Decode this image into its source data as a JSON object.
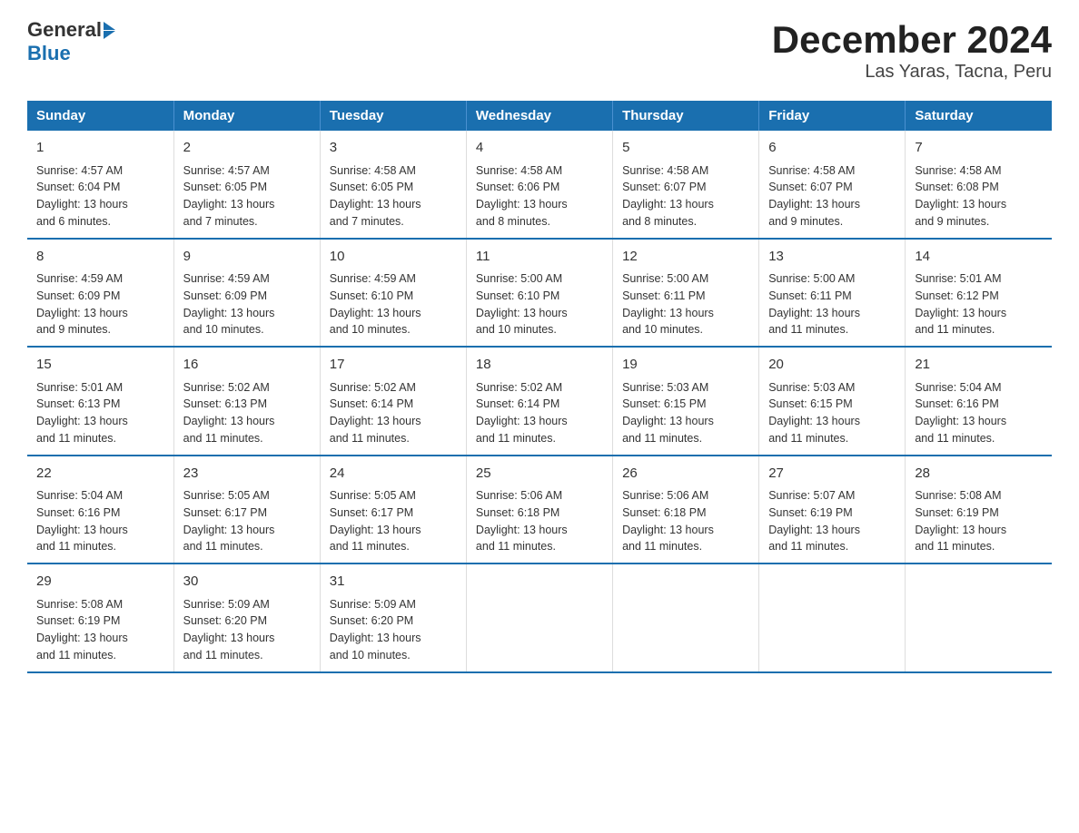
{
  "logo": {
    "general": "General",
    "blue": "Blue"
  },
  "title": "December 2024",
  "subtitle": "Las Yaras, Tacna, Peru",
  "days_of_week": [
    "Sunday",
    "Monday",
    "Tuesday",
    "Wednesday",
    "Thursday",
    "Friday",
    "Saturday"
  ],
  "weeks": [
    [
      {
        "day": "1",
        "info": "Sunrise: 4:57 AM\nSunset: 6:04 PM\nDaylight: 13 hours\nand 6 minutes."
      },
      {
        "day": "2",
        "info": "Sunrise: 4:57 AM\nSunset: 6:05 PM\nDaylight: 13 hours\nand 7 minutes."
      },
      {
        "day": "3",
        "info": "Sunrise: 4:58 AM\nSunset: 6:05 PM\nDaylight: 13 hours\nand 7 minutes."
      },
      {
        "day": "4",
        "info": "Sunrise: 4:58 AM\nSunset: 6:06 PM\nDaylight: 13 hours\nand 8 minutes."
      },
      {
        "day": "5",
        "info": "Sunrise: 4:58 AM\nSunset: 6:07 PM\nDaylight: 13 hours\nand 8 minutes."
      },
      {
        "day": "6",
        "info": "Sunrise: 4:58 AM\nSunset: 6:07 PM\nDaylight: 13 hours\nand 9 minutes."
      },
      {
        "day": "7",
        "info": "Sunrise: 4:58 AM\nSunset: 6:08 PM\nDaylight: 13 hours\nand 9 minutes."
      }
    ],
    [
      {
        "day": "8",
        "info": "Sunrise: 4:59 AM\nSunset: 6:09 PM\nDaylight: 13 hours\nand 9 minutes."
      },
      {
        "day": "9",
        "info": "Sunrise: 4:59 AM\nSunset: 6:09 PM\nDaylight: 13 hours\nand 10 minutes."
      },
      {
        "day": "10",
        "info": "Sunrise: 4:59 AM\nSunset: 6:10 PM\nDaylight: 13 hours\nand 10 minutes."
      },
      {
        "day": "11",
        "info": "Sunrise: 5:00 AM\nSunset: 6:10 PM\nDaylight: 13 hours\nand 10 minutes."
      },
      {
        "day": "12",
        "info": "Sunrise: 5:00 AM\nSunset: 6:11 PM\nDaylight: 13 hours\nand 10 minutes."
      },
      {
        "day": "13",
        "info": "Sunrise: 5:00 AM\nSunset: 6:11 PM\nDaylight: 13 hours\nand 11 minutes."
      },
      {
        "day": "14",
        "info": "Sunrise: 5:01 AM\nSunset: 6:12 PM\nDaylight: 13 hours\nand 11 minutes."
      }
    ],
    [
      {
        "day": "15",
        "info": "Sunrise: 5:01 AM\nSunset: 6:13 PM\nDaylight: 13 hours\nand 11 minutes."
      },
      {
        "day": "16",
        "info": "Sunrise: 5:02 AM\nSunset: 6:13 PM\nDaylight: 13 hours\nand 11 minutes."
      },
      {
        "day": "17",
        "info": "Sunrise: 5:02 AM\nSunset: 6:14 PM\nDaylight: 13 hours\nand 11 minutes."
      },
      {
        "day": "18",
        "info": "Sunrise: 5:02 AM\nSunset: 6:14 PM\nDaylight: 13 hours\nand 11 minutes."
      },
      {
        "day": "19",
        "info": "Sunrise: 5:03 AM\nSunset: 6:15 PM\nDaylight: 13 hours\nand 11 minutes."
      },
      {
        "day": "20",
        "info": "Sunrise: 5:03 AM\nSunset: 6:15 PM\nDaylight: 13 hours\nand 11 minutes."
      },
      {
        "day": "21",
        "info": "Sunrise: 5:04 AM\nSunset: 6:16 PM\nDaylight: 13 hours\nand 11 minutes."
      }
    ],
    [
      {
        "day": "22",
        "info": "Sunrise: 5:04 AM\nSunset: 6:16 PM\nDaylight: 13 hours\nand 11 minutes."
      },
      {
        "day": "23",
        "info": "Sunrise: 5:05 AM\nSunset: 6:17 PM\nDaylight: 13 hours\nand 11 minutes."
      },
      {
        "day": "24",
        "info": "Sunrise: 5:05 AM\nSunset: 6:17 PM\nDaylight: 13 hours\nand 11 minutes."
      },
      {
        "day": "25",
        "info": "Sunrise: 5:06 AM\nSunset: 6:18 PM\nDaylight: 13 hours\nand 11 minutes."
      },
      {
        "day": "26",
        "info": "Sunrise: 5:06 AM\nSunset: 6:18 PM\nDaylight: 13 hours\nand 11 minutes."
      },
      {
        "day": "27",
        "info": "Sunrise: 5:07 AM\nSunset: 6:19 PM\nDaylight: 13 hours\nand 11 minutes."
      },
      {
        "day": "28",
        "info": "Sunrise: 5:08 AM\nSunset: 6:19 PM\nDaylight: 13 hours\nand 11 minutes."
      }
    ],
    [
      {
        "day": "29",
        "info": "Sunrise: 5:08 AM\nSunset: 6:19 PM\nDaylight: 13 hours\nand 11 minutes."
      },
      {
        "day": "30",
        "info": "Sunrise: 5:09 AM\nSunset: 6:20 PM\nDaylight: 13 hours\nand 11 minutes."
      },
      {
        "day": "31",
        "info": "Sunrise: 5:09 AM\nSunset: 6:20 PM\nDaylight: 13 hours\nand 10 minutes."
      },
      {
        "day": "",
        "info": ""
      },
      {
        "day": "",
        "info": ""
      },
      {
        "day": "",
        "info": ""
      },
      {
        "day": "",
        "info": ""
      }
    ]
  ]
}
